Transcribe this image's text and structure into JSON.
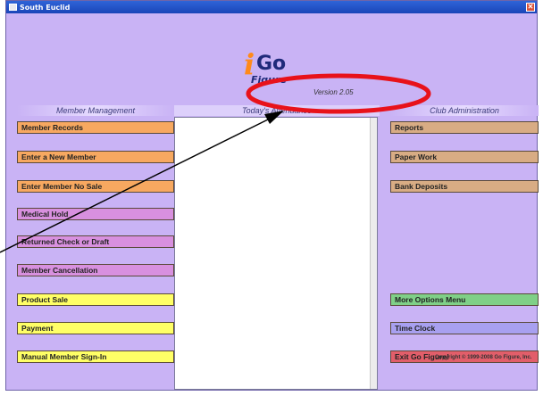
{
  "window": {
    "title": "South Euclid",
    "close_glyph": "✕"
  },
  "logo": {
    "i": "i",
    "go": "Go",
    "figure": "Figure"
  },
  "version": "Version 2.05",
  "headers": {
    "member_management": "Member Management",
    "todays_attendance": "Today's Attendance",
    "club_administration": "Club Administration"
  },
  "left_buttons": [
    {
      "label": "Member Records",
      "color": "#f7a860"
    },
    {
      "label": "Enter a New Member",
      "color": "#f7a860"
    },
    {
      "label": "Enter Member No Sale",
      "color": "#f7a860"
    },
    {
      "label": "Medical Hold",
      "color": "#d890df"
    },
    {
      "label": "Returned Check or Draft",
      "color": "#d890df"
    },
    {
      "label": "Member Cancellation",
      "color": "#d890df"
    },
    {
      "label": "Product Sale",
      "color": "#ffff66"
    },
    {
      "label": "Payment",
      "color": "#ffff66"
    },
    {
      "label": "Manual Member Sign-In",
      "color": "#ffff66"
    }
  ],
  "right_buttons": [
    {
      "label": "Reports",
      "color": "#d8ac84"
    },
    {
      "label": "Paper Work",
      "color": "#d8ac84"
    },
    {
      "label": "Bank Deposits",
      "color": "#d8ac84"
    },
    {
      "label": "More Options Menu",
      "color": "#7fd087"
    },
    {
      "label": "Time Clock",
      "color": "#a8a0f0"
    },
    {
      "label": "Exit Go Figure!",
      "color": "#e25e6a"
    }
  ],
  "copyright": "Copyright © 1999-2008 Go Figure, Inc.",
  "colors": {
    "background": "#c9b3f5",
    "annotation_ellipse": "#e8121a",
    "arrow": "#000000"
  }
}
